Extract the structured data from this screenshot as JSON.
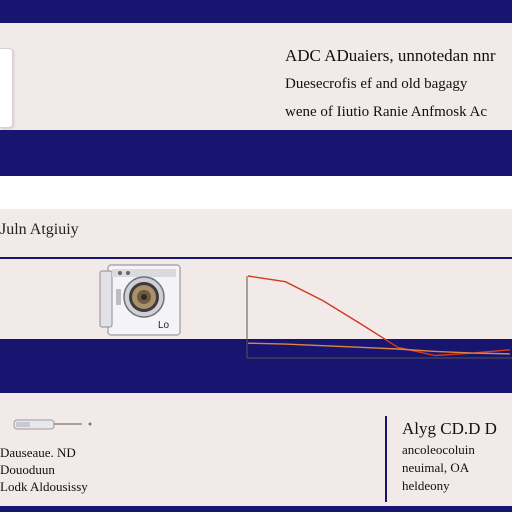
{
  "header": {
    "line1": "ADC ADuaiers, unnotedan nnr",
    "line2": "Duesecrofis ef and old bagagy",
    "line3": "wene of Iiutio Ranie Anfmosk Ac"
  },
  "section": {
    "title": "Juln Atgiuiy"
  },
  "product": {
    "label": "Lo"
  },
  "left_info": {
    "line1": "Dauseaue. ND",
    "line2": "Douoduun",
    "line3": "Lodk Aldousissy"
  },
  "right_info": {
    "title": "Alyg CD.D D",
    "line1": "ancoleocoluin",
    "line2": "neuimal, OA",
    "line3": "heldeony"
  },
  "chart_data": {
    "type": "line",
    "title": "",
    "xlabel": "",
    "ylabel": "",
    "series": [
      {
        "color": "#d23a1c",
        "values": [
          1.0,
          0.93,
          0.7,
          0.42,
          0.13,
          0.03,
          0.06,
          0.1
        ]
      },
      {
        "color": "#e2853a",
        "values": [
          0.18,
          0.17,
          0.15,
          0.13,
          0.11,
          0.08,
          0.06,
          0.05
        ]
      }
    ],
    "ylim": [
      0,
      1
    ]
  }
}
